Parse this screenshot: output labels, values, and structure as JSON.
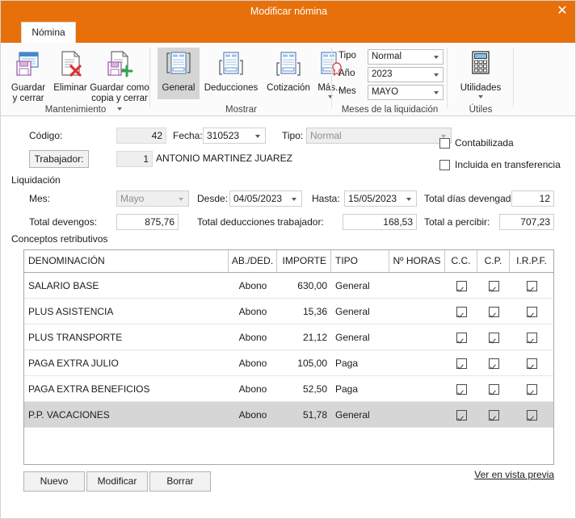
{
  "window": {
    "title": "Modificar nómina",
    "close_icon": "close-icon",
    "accent_color": "#e8700a"
  },
  "tabs": [
    {
      "label": "Nómina",
      "active": true
    }
  ],
  "ribbon": {
    "groups": [
      {
        "label": "Mantenimiento"
      },
      {
        "label": "Mostrar"
      },
      {
        "label": "Meses de la liquidación"
      },
      {
        "label": "Útiles"
      }
    ],
    "buttons": {
      "guardar_cerrar": "Guardar\ny cerrar",
      "guardar_cerrar_l1": "Guardar",
      "guardar_cerrar_l2": "y cerrar",
      "eliminar": "Eliminar",
      "guardar_copia_l1": "Guardar como",
      "guardar_copia_l2": "copia y cerrar",
      "general": "General",
      "deducciones": "Deducciones",
      "cotizacion": "Cotización",
      "mas": "Más...",
      "utilidades": "Utilidades"
    },
    "fields": {
      "tipo_label": "Tipo",
      "tipo_value": "Normal",
      "anio_label": "Año",
      "anio_value": "2023",
      "mes_label": "Mes",
      "mes_value": "MAYO"
    }
  },
  "form": {
    "codigo_label": "Código:",
    "codigo_value": "42",
    "fecha_label": "Fecha:",
    "fecha_value": "310523",
    "tipo_label": "Tipo:",
    "tipo_value": "Normal",
    "trabajador_button": "Trabajador:",
    "trabajador_code": "1",
    "trabajador_name": "ANTONIO MARTINEZ JUAREZ",
    "contabilizada_label": "Contabilizada",
    "contabilizada_checked": false,
    "transferencia_label": "Incluida en transferencia",
    "transferencia_checked": false,
    "liquidacion_label": "Liquidación",
    "mes_label": "Mes:",
    "mes_value": "Mayo",
    "desde_label": "Desde:",
    "desde_value": "04/05/2023",
    "hasta_label": "Hasta:",
    "hasta_value": "15/05/2023",
    "total_dias_label": "Total días devengados:",
    "total_dias_value": "12",
    "total_devengos_label": "Total devengos:",
    "total_devengos_value": "875,76",
    "total_deducciones_label": "Total deducciones trabajador:",
    "total_deducciones_value": "168,53",
    "total_percibir_label": "Total a percibir:",
    "total_percibir_value": "707,23"
  },
  "grid": {
    "section_label": "Conceptos retributivos",
    "columns": [
      "DENOMINACIÓN",
      "AB./DED.",
      "IMPORTE",
      "TIPO",
      "Nº HORAS",
      "C.C.",
      "C.P.",
      "I.R.P.F."
    ],
    "rows": [
      {
        "denominacion": "SALARIO BASE",
        "abded": "Abono",
        "importe": "630,00",
        "tipo": "General",
        "horas": "",
        "cc": true,
        "cp": true,
        "irpf": true,
        "selected": false
      },
      {
        "denominacion": "PLUS ASISTENCIA",
        "abded": "Abono",
        "importe": "15,36",
        "tipo": "General",
        "horas": "",
        "cc": true,
        "cp": true,
        "irpf": true,
        "selected": false
      },
      {
        "denominacion": "PLUS TRANSPORTE",
        "abded": "Abono",
        "importe": "21,12",
        "tipo": "General",
        "horas": "",
        "cc": true,
        "cp": true,
        "irpf": true,
        "selected": false
      },
      {
        "denominacion": "PAGA EXTRA JULIO",
        "abded": "Abono",
        "importe": "105,00",
        "tipo": "Paga",
        "horas": "",
        "cc": true,
        "cp": true,
        "irpf": true,
        "selected": false
      },
      {
        "denominacion": "PAGA EXTRA BENEFICIOS",
        "abded": "Abono",
        "importe": "52,50",
        "tipo": "Paga",
        "horas": "",
        "cc": true,
        "cp": true,
        "irpf": true,
        "selected": false
      },
      {
        "denominacion": "P.P. VACACIONES",
        "abded": "Abono",
        "importe": "51,78",
        "tipo": "General",
        "horas": "",
        "cc": true,
        "cp": true,
        "irpf": true,
        "selected": true
      }
    ]
  },
  "footer": {
    "nuevo": "Nuevo",
    "modificar": "Modificar",
    "borrar": "Borrar",
    "preview_link": "Ver en vista previa"
  }
}
